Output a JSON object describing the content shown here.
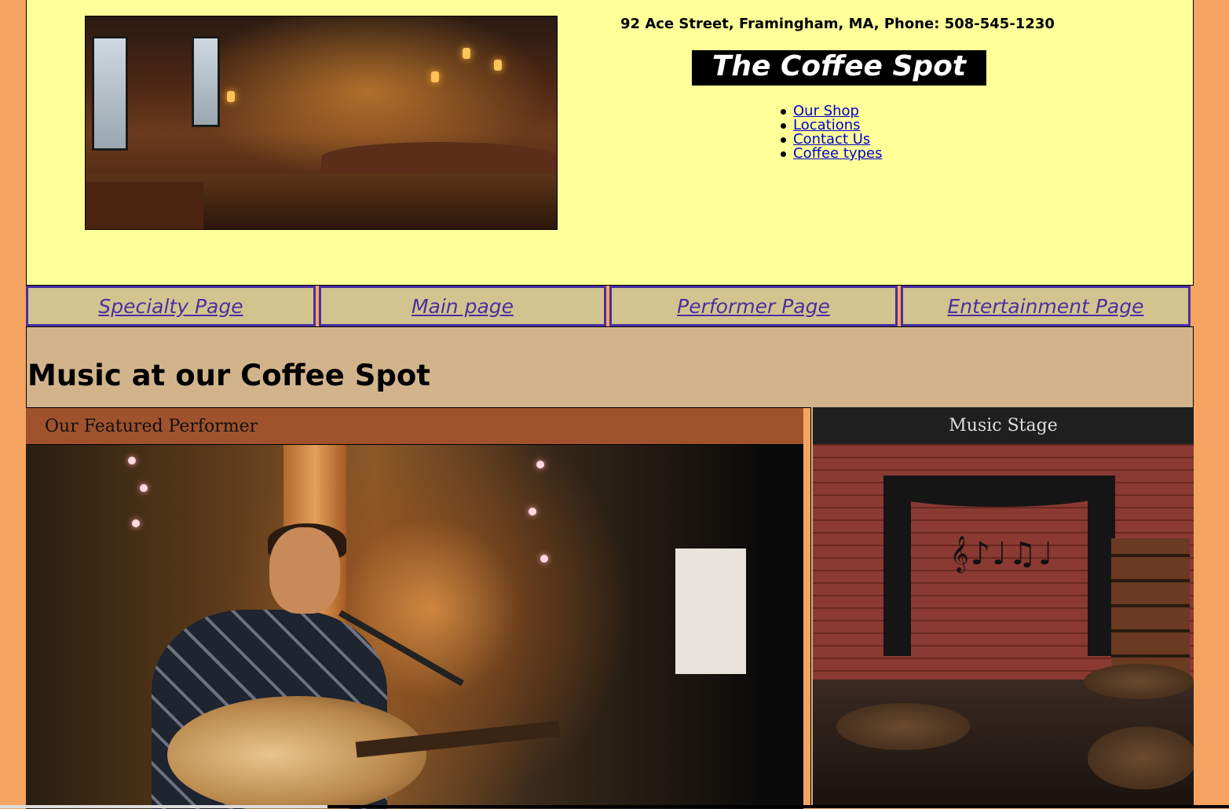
{
  "header": {
    "address": "92 Ace Street, Framingham, MA, Phone: 508-545-1230",
    "brand": "The Coffee Spot",
    "links": [
      "Our Shop",
      "Locations",
      "Contact Us",
      "Coffee types"
    ]
  },
  "nav": {
    "items": [
      "Specialty Page",
      "Main page",
      "Performer Page",
      "Entertainment Page"
    ]
  },
  "section": {
    "title": "Music at our Coffee Spot"
  },
  "featured": {
    "heading": "Our Featured Performer"
  },
  "stage": {
    "heading": "Music Stage",
    "notes": "𝄞♪♩♫♩"
  },
  "colors": {
    "page_bg": "#f4a460",
    "header_bg": "#ffff99",
    "nav_bg": "#d2c48f",
    "nav_border": "#4b2fa0",
    "section_bg": "#d2b48c",
    "featured_head": "#a0522d",
    "stage_head": "#1f1f1f"
  }
}
